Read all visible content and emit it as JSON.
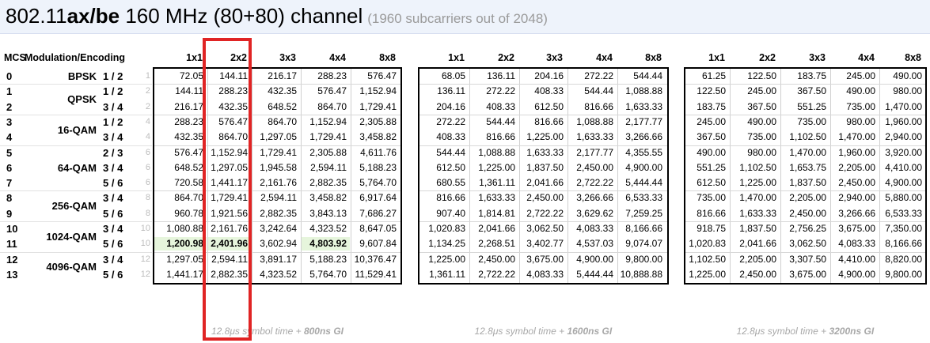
{
  "title": {
    "prefix": "802.11",
    "bold": "ax/be",
    "suffix": " 160 MHz (80+80) channel",
    "sub": "(1960 subcarriers out of 2048)"
  },
  "headers": {
    "mcs": "MCS",
    "modulation": "Modulation/Encoding",
    "streams": [
      "1x1",
      "2x2",
      "3x3",
      "4x4",
      "8x8"
    ]
  },
  "rows": [
    {
      "mcs": "0",
      "enc": "1 / 2",
      "idx": "1",
      "t1": [
        "72.05",
        "144.11",
        "216.17",
        "288.23",
        "576.47"
      ],
      "t2": [
        "68.05",
        "136.11",
        "204.16",
        "272.22",
        "544.44"
      ],
      "t3": [
        "61.25",
        "122.50",
        "183.75",
        "245.00",
        "490.00"
      ]
    },
    {
      "mcs": "1",
      "enc": "1 / 2",
      "idx": "2",
      "t1": [
        "144.11",
        "288.23",
        "432.35",
        "576.47",
        "1,152.94"
      ],
      "t2": [
        "136.11",
        "272.22",
        "408.33",
        "544.44",
        "1,088.88"
      ],
      "t3": [
        "122.50",
        "245.00",
        "367.50",
        "490.00",
        "980.00"
      ]
    },
    {
      "mcs": "2",
      "enc": "3 / 4",
      "idx": "2",
      "t1": [
        "216.17",
        "432.35",
        "648.52",
        "864.70",
        "1,729.41"
      ],
      "t2": [
        "204.16",
        "408.33",
        "612.50",
        "816.66",
        "1,633.33"
      ],
      "t3": [
        "183.75",
        "367.50",
        "551.25",
        "735.00",
        "1,470.00"
      ]
    },
    {
      "mcs": "3",
      "enc": "1 / 2",
      "idx": "4",
      "t1": [
        "288.23",
        "576.47",
        "864.70",
        "1,152.94",
        "2,305.88"
      ],
      "t2": [
        "272.22",
        "544.44",
        "816.66",
        "1,088.88",
        "2,177.77"
      ],
      "t3": [
        "245.00",
        "490.00",
        "735.00",
        "980.00",
        "1,960.00"
      ]
    },
    {
      "mcs": "4",
      "enc": "3 / 4",
      "idx": "4",
      "t1": [
        "432.35",
        "864.70",
        "1,297.05",
        "1,729.41",
        "3,458.82"
      ],
      "t2": [
        "408.33",
        "816.66",
        "1,225.00",
        "1,633.33",
        "3,266.66"
      ],
      "t3": [
        "367.50",
        "735.00",
        "1,102.50",
        "1,470.00",
        "2,940.00"
      ]
    },
    {
      "mcs": "5",
      "enc": "2 / 3",
      "idx": "6",
      "t1": [
        "576.47",
        "1,152.94",
        "1,729.41",
        "2,305.88",
        "4,611.76"
      ],
      "t2": [
        "544.44",
        "1,088.88",
        "1,633.33",
        "2,177.77",
        "4,355.55"
      ],
      "t3": [
        "490.00",
        "980.00",
        "1,470.00",
        "1,960.00",
        "3,920.00"
      ]
    },
    {
      "mcs": "6",
      "enc": "3 / 4",
      "idx": "6",
      "t1": [
        "648.52",
        "1,297.05",
        "1,945.58",
        "2,594.11",
        "5,188.23"
      ],
      "t2": [
        "612.50",
        "1,225.00",
        "1,837.50",
        "2,450.00",
        "4,900.00"
      ],
      "t3": [
        "551.25",
        "1,102.50",
        "1,653.75",
        "2,205.00",
        "4,410.00"
      ]
    },
    {
      "mcs": "7",
      "enc": "5 / 6",
      "idx": "6",
      "t1": [
        "720.58",
        "1,441.17",
        "2,161.76",
        "2,882.35",
        "5,764.70"
      ],
      "t2": [
        "680.55",
        "1,361.11",
        "2,041.66",
        "2,722.22",
        "5,444.44"
      ],
      "t3": [
        "612.50",
        "1,225.00",
        "1,837.50",
        "2,450.00",
        "4,900.00"
      ]
    },
    {
      "mcs": "8",
      "enc": "3 / 4",
      "idx": "8",
      "t1": [
        "864.70",
        "1,729.41",
        "2,594.11",
        "3,458.82",
        "6,917.64"
      ],
      "t2": [
        "816.66",
        "1,633.33",
        "2,450.00",
        "3,266.66",
        "6,533.33"
      ],
      "t3": [
        "735.00",
        "1,470.00",
        "2,205.00",
        "2,940.00",
        "5,880.00"
      ]
    },
    {
      "mcs": "9",
      "enc": "5 / 6",
      "idx": "8",
      "t1": [
        "960.78",
        "1,921.56",
        "2,882.35",
        "3,843.13",
        "7,686.27"
      ],
      "t2": [
        "907.40",
        "1,814.81",
        "2,722.22",
        "3,629.62",
        "7,259.25"
      ],
      "t3": [
        "816.66",
        "1,633.33",
        "2,450.00",
        "3,266.66",
        "6,533.33"
      ]
    },
    {
      "mcs": "10",
      "enc": "3 / 4",
      "idx": "10",
      "t1": [
        "1,080.88",
        "2,161.76",
        "3,242.64",
        "4,323.52",
        "8,647.05"
      ],
      "t2": [
        "1,020.83",
        "2,041.66",
        "3,062.50",
        "4,083.33",
        "8,166.66"
      ],
      "t3": [
        "918.75",
        "1,837.50",
        "2,756.25",
        "3,675.00",
        "7,350.00"
      ]
    },
    {
      "mcs": "11",
      "enc": "5 / 6",
      "idx": "10",
      "t1": [
        "1,200.98",
        "2,401.96",
        "3,602.94",
        "4,803.92",
        "9,607.84"
      ],
      "t2": [
        "1,134.25",
        "2,268.51",
        "3,402.77",
        "4,537.03",
        "9,074.07"
      ],
      "t3": [
        "1,020.83",
        "2,041.66",
        "3,062.50",
        "4,083.33",
        "8,166.66"
      ]
    },
    {
      "mcs": "12",
      "enc": "3 / 4",
      "idx": "12",
      "t1": [
        "1,297.05",
        "2,594.11",
        "3,891.17",
        "5,188.23",
        "10,376.47"
      ],
      "t2": [
        "1,225.00",
        "2,450.00",
        "3,675.00",
        "4,900.00",
        "9,800.00"
      ],
      "t3": [
        "1,102.50",
        "2,205.00",
        "3,307.50",
        "4,410.00",
        "8,820.00"
      ]
    },
    {
      "mcs": "13",
      "enc": "5 / 6",
      "idx": "12",
      "t1": [
        "1,441.17",
        "2,882.35",
        "4,323.52",
        "5,764.70",
        "11,529.41"
      ],
      "t2": [
        "1,361.11",
        "2,722.22",
        "4,083.33",
        "5,444.44",
        "10,888.88"
      ],
      "t3": [
        "1,225.00",
        "2,450.00",
        "3,675.00",
        "4,900.00",
        "9,800.00"
      ]
    }
  ],
  "modulations": [
    {
      "label": "BPSK",
      "rows": [
        0
      ]
    },
    {
      "label": "QPSK",
      "rows": [
        1,
        2
      ]
    },
    {
      "label": "16-QAM",
      "rows": [
        3,
        4
      ]
    },
    {
      "label": "64-QAM",
      "rows": [
        5,
        6,
        7
      ]
    },
    {
      "label": "256-QAM",
      "rows": [
        8,
        9
      ]
    },
    {
      "label": "1024-QAM",
      "rows": [
        10,
        11
      ]
    },
    {
      "label": "4096-QAM",
      "rows": [
        12,
        13
      ]
    }
  ],
  "captions": [
    {
      "text": "12.8μs symbol time + ",
      "bold": "800ns GI"
    },
    {
      "text": "12.8μs symbol time + ",
      "bold": "1600ns GI"
    },
    {
      "text": "12.8μs symbol time + ",
      "bold": "3200ns GI"
    }
  ],
  "highlight_color": "#e02424",
  "green_fill": "#e6f5dc"
}
